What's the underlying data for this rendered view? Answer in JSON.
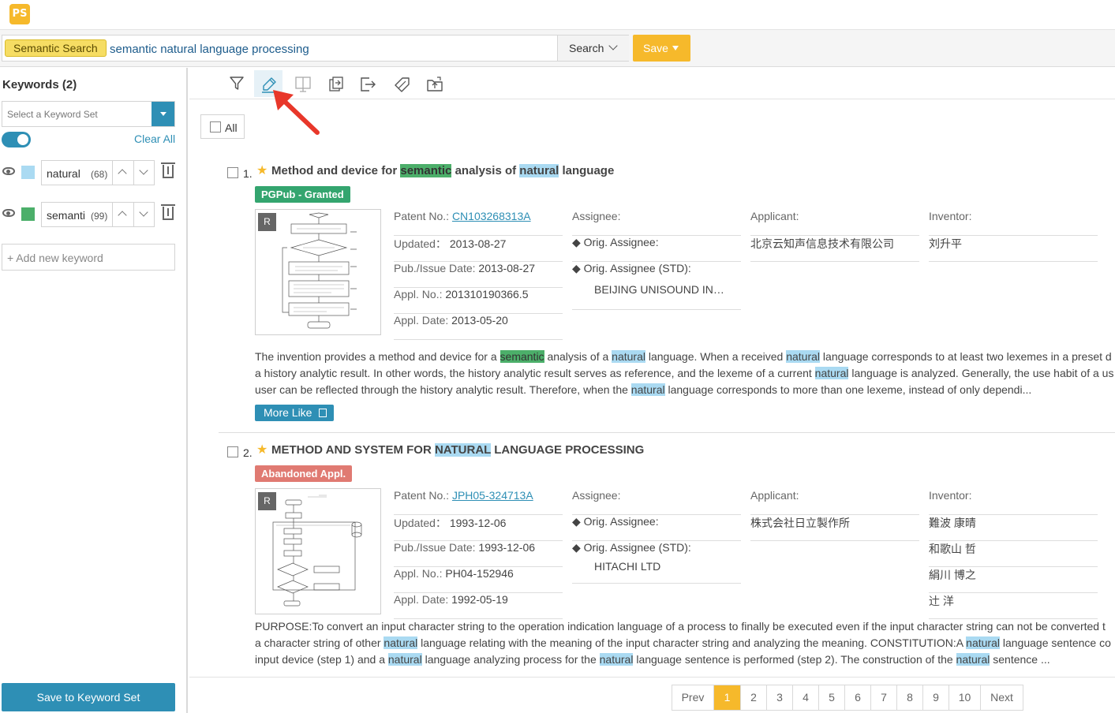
{
  "app": {
    "logo_text": "PS"
  },
  "search": {
    "mode_tag": "Semantic Search",
    "query": "semantic natural language processing",
    "search_label": "Search",
    "save_label": "Save"
  },
  "sidebar": {
    "title": "Keywords (2)",
    "keyword_set_placeholder": "Select a Keyword Set",
    "clear_all": "Clear All",
    "keywords": [
      {
        "word": "natural",
        "count": "(68)",
        "color": "#aadaf2"
      },
      {
        "word": "semanti",
        "count": "(99)",
        "color": "#4caf6a"
      }
    ],
    "add_placeholder": "+ Add new keyword",
    "save_to_set": "Save to Keyword Set"
  },
  "toolbar": {
    "icons": [
      "filter-icon",
      "highlighter-icon",
      "split-view-icon",
      "compare-icon",
      "export-icon",
      "tag-icon",
      "save-to-folder-icon"
    ],
    "active": "highlighter-icon"
  },
  "select_all": "All",
  "results": [
    {
      "index": "1.",
      "title_parts": [
        {
          "text": "Method and device for ",
          "hl": ""
        },
        {
          "text": "semantic",
          "hl": "g"
        },
        {
          "text": " analysis of ",
          "hl": ""
        },
        {
          "text": "natural",
          "hl": "b"
        },
        {
          "text": " language",
          "hl": ""
        }
      ],
      "status": "PGPub - Granted",
      "status_color": "#34a56f",
      "thumb_label": "R",
      "patent_no_label": "Patent No.:",
      "patent_no": "CN103268313A",
      "updated_label": "Updated：",
      "updated": "2013-08-27",
      "pub_label": "Pub./Issue Date:",
      "pub_date": "2013-08-27",
      "appl_no_label": "Appl. No.:",
      "appl_no": "201310190366.5",
      "appl_date_label": "Appl. Date:",
      "appl_date": "2013-05-20",
      "assignee_label": "Assignee:",
      "orig_assignee_label": "◆ Orig. Assignee:",
      "orig_assignee_std_label": "◆ Orig. Assignee (STD):",
      "orig_assignee_std": "BEIJING UNISOUND IN…",
      "applicant_label": "Applicant:",
      "applicants": [
        "北京云知声信息技术有限公司"
      ],
      "inventor_label": "Inventor:",
      "inventors": [
        "刘升平"
      ],
      "abstract_lines": [
        [
          {
            "text": "The invention provides a method and device for a ",
            "hl": ""
          },
          {
            "text": "semantic",
            "hl": "g"
          },
          {
            "text": " analysis of a ",
            "hl": ""
          },
          {
            "text": "natural",
            "hl": "b"
          },
          {
            "text": " language. When a received ",
            "hl": ""
          },
          {
            "text": "natural",
            "hl": "b"
          },
          {
            "text": " language corresponds to at least two lexemes in a preset d",
            "hl": ""
          }
        ],
        [
          {
            "text": "a history analytic result. In other words, the history analytic result serves as reference, and the lexeme of a current ",
            "hl": ""
          },
          {
            "text": "natural",
            "hl": "b"
          },
          {
            "text": " language is analyzed. Generally, the use habit of a us",
            "hl": ""
          }
        ],
        [
          {
            "text": "user can be reflected through the history analytic result. Therefore, when the ",
            "hl": ""
          },
          {
            "text": "natural",
            "hl": "b"
          },
          {
            "text": " language corresponds to more than one lexeme, instead of only dependi...",
            "hl": ""
          }
        ]
      ],
      "more_like": "More Like"
    },
    {
      "index": "2.",
      "title_parts": [
        {
          "text": "METHOD AND SYSTEM FOR ",
          "hl": ""
        },
        {
          "text": "NATURAL",
          "hl": "b"
        },
        {
          "text": " LANGUAGE PROCESSING",
          "hl": ""
        }
      ],
      "status": "Abandoned Appl.",
      "status_color": "#e07a72",
      "thumb_label": "R",
      "patent_no_label": "Patent No.:",
      "patent_no": "JPH05-324713A",
      "updated_label": "Updated：",
      "updated": "1993-12-06",
      "pub_label": "Pub./Issue Date:",
      "pub_date": "1993-12-06",
      "appl_no_label": "Appl. No.:",
      "appl_no": "PH04-152946",
      "appl_date_label": "Appl. Date:",
      "appl_date": "1992-05-19",
      "assignee_label": "Assignee:",
      "orig_assignee_label": "◆ Orig. Assignee:",
      "orig_assignee_std_label": "◆ Orig. Assignee (STD):",
      "orig_assignee_std": "HITACHI LTD",
      "applicant_label": "Applicant:",
      "applicants": [
        "株式会社日立製作所"
      ],
      "inventor_label": "Inventor:",
      "inventors": [
        "難波 康晴",
        "和歌山 哲",
        "絹川 博之",
        "辻 洋"
      ],
      "abstract_lines": [
        [
          {
            "text": "PURPOSE:To convert an input character string to the operation indication language of a process to finally be executed even if the input character string can not be converted t",
            "hl": ""
          }
        ],
        [
          {
            "text": "a character string of other ",
            "hl": ""
          },
          {
            "text": "natural",
            "hl": "b"
          },
          {
            "text": " language relating with the meaning of the input character string and analyzing the meaning. CONSTITUTION:A ",
            "hl": ""
          },
          {
            "text": "natural",
            "hl": "b"
          },
          {
            "text": " language sentence co",
            "hl": ""
          }
        ],
        [
          {
            "text": "input device (step 1) and a ",
            "hl": ""
          },
          {
            "text": "natural",
            "hl": "b"
          },
          {
            "text": " language analyzing process for the ",
            "hl": ""
          },
          {
            "text": "natural",
            "hl": "b"
          },
          {
            "text": " language sentence is performed (step 2). The construction of the ",
            "hl": ""
          },
          {
            "text": "natural",
            "hl": "b"
          },
          {
            "text": " sentence ...",
            "hl": ""
          }
        ]
      ]
    }
  ],
  "pagination": {
    "prev": "Prev",
    "pages": [
      "1",
      "2",
      "3",
      "4",
      "5",
      "6",
      "7",
      "8",
      "9",
      "10"
    ],
    "current": "1",
    "next": "Next"
  }
}
